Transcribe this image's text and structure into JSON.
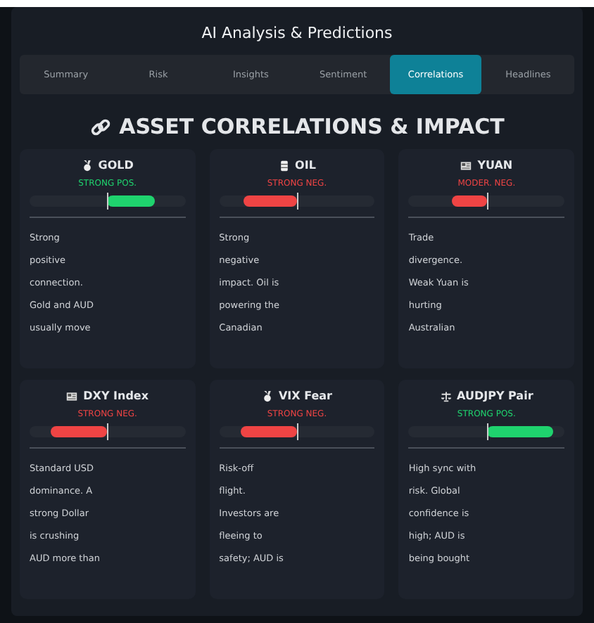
{
  "panel": {
    "title": "AI Analysis & Predictions"
  },
  "tabs": [
    {
      "label": "Summary",
      "selected": false
    },
    {
      "label": "Risk",
      "selected": false
    },
    {
      "label": "Insights",
      "selected": false
    },
    {
      "label": "Sentiment",
      "selected": false
    },
    {
      "label": "Correlations",
      "selected": true
    },
    {
      "label": "Headlines",
      "selected": false
    }
  ],
  "section": {
    "title": "ASSET CORRELATIONS & IMPACT"
  },
  "assets": [
    {
      "kind": "medal",
      "name": "GOLD",
      "status": "STRONG POS.",
      "color": "#1fd36e",
      "lines": [
        "Strong",
        "positive",
        "connection.",
        "Gold and AUD",
        "usually move"
      ]
    },
    {
      "kind": "barrel",
      "name": "OIL",
      "status": "STRONG NEG.",
      "color": "#ef4444",
      "lines": [
        "Strong",
        "negative",
        "impact. Oil is",
        "powering the",
        "Canadian"
      ]
    },
    {
      "kind": "flag",
      "name": "YUAN",
      "status": "MODER. NEG.",
      "color": "#ef4444",
      "lines": [
        "Trade",
        "divergence.",
        "Weak Yuan is",
        "hurting",
        "Australian"
      ]
    },
    {
      "kind": "flag",
      "name": "DXY Index",
      "status": "STRONG NEG.",
      "color": "#ef4444",
      "lines": [
        "Standard USD",
        "dominance. A",
        "strong Dollar",
        "is crushing",
        "AUD more than"
      ]
    },
    {
      "kind": "medal",
      "name": "VIX Fear",
      "status": "STRONG NEG.",
      "color": "#ef4444",
      "lines": [
        "Risk-off",
        "flight.",
        "Investors are",
        "fleeing to",
        "safety; AUD is"
      ]
    },
    {
      "kind": "scale",
      "name": "AUDJPY Pair",
      "status": "STRONG POS.",
      "color": "#1fd36e",
      "lines": [
        "High sync with",
        "risk. Global",
        "confidence is",
        "high; AUD is",
        "being bought"
      ]
    }
  ]
}
